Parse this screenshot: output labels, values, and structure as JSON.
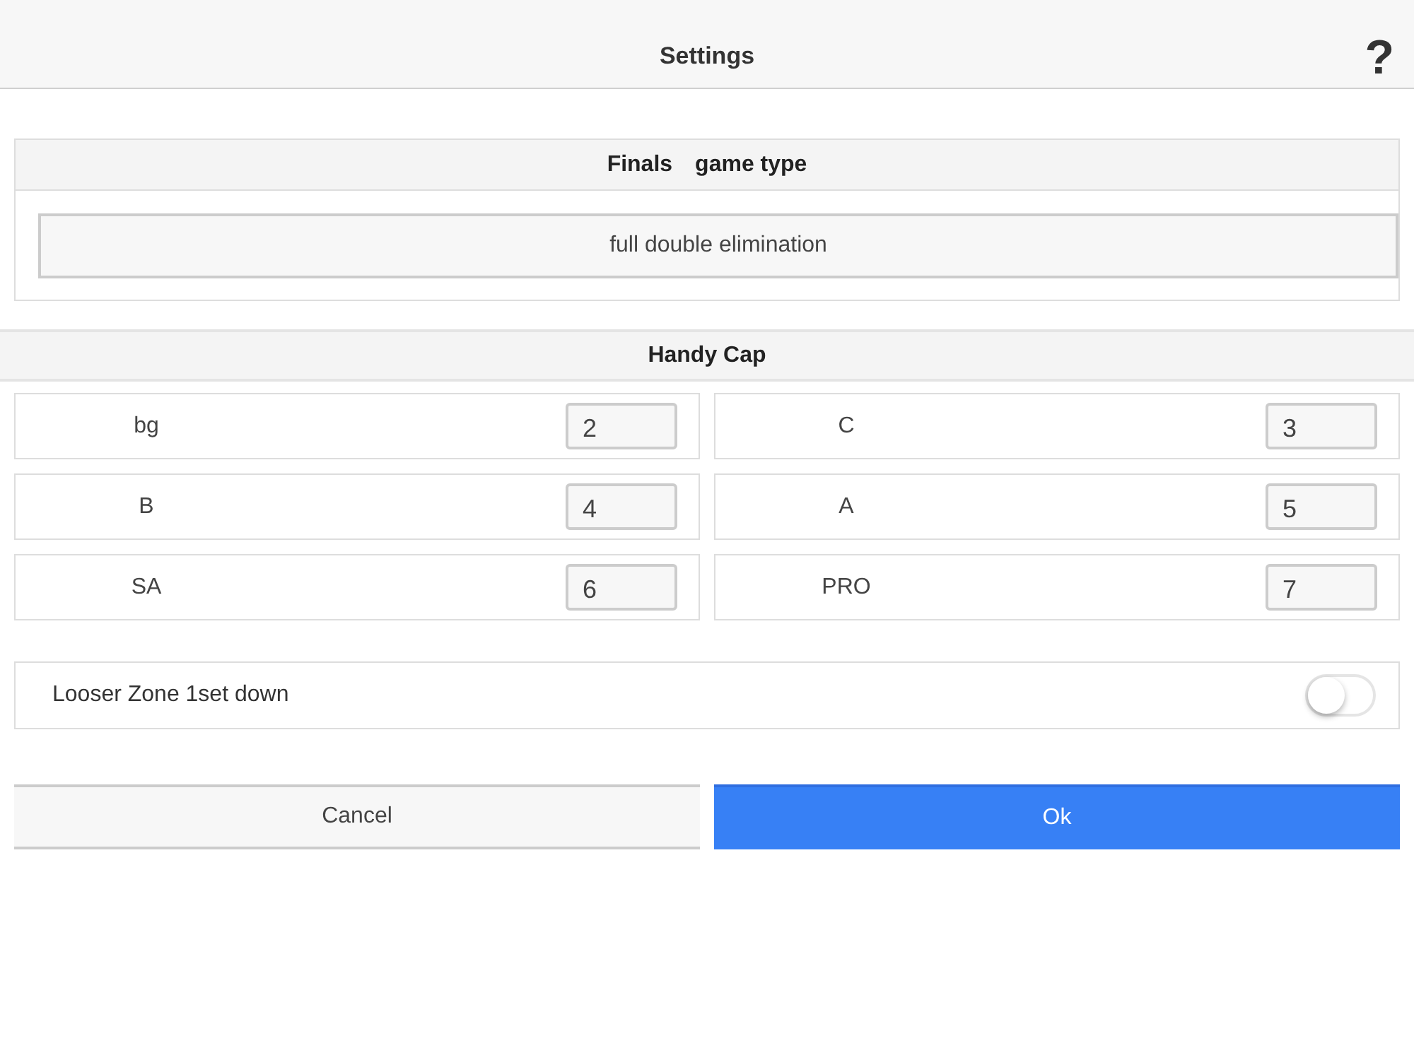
{
  "header": {
    "title": "Settings",
    "help": "?"
  },
  "finals": {
    "title_parts": [
      "Finals",
      "game type"
    ],
    "value": "full double elimination"
  },
  "handicap": {
    "title": "Handy Cap",
    "items": [
      {
        "label": "bg",
        "value": "2"
      },
      {
        "label": "C",
        "value": "3"
      },
      {
        "label": "B",
        "value": "4"
      },
      {
        "label": "A",
        "value": "5"
      },
      {
        "label": "SA",
        "value": "6"
      },
      {
        "label": "PRO",
        "value": "7"
      }
    ]
  },
  "toggle": {
    "label": "Looser Zone 1set down",
    "on": false
  },
  "buttons": [
    {
      "label": "Cancel",
      "kind": "secondary"
    },
    {
      "label": "Ok",
      "kind": "primary"
    }
  ]
}
